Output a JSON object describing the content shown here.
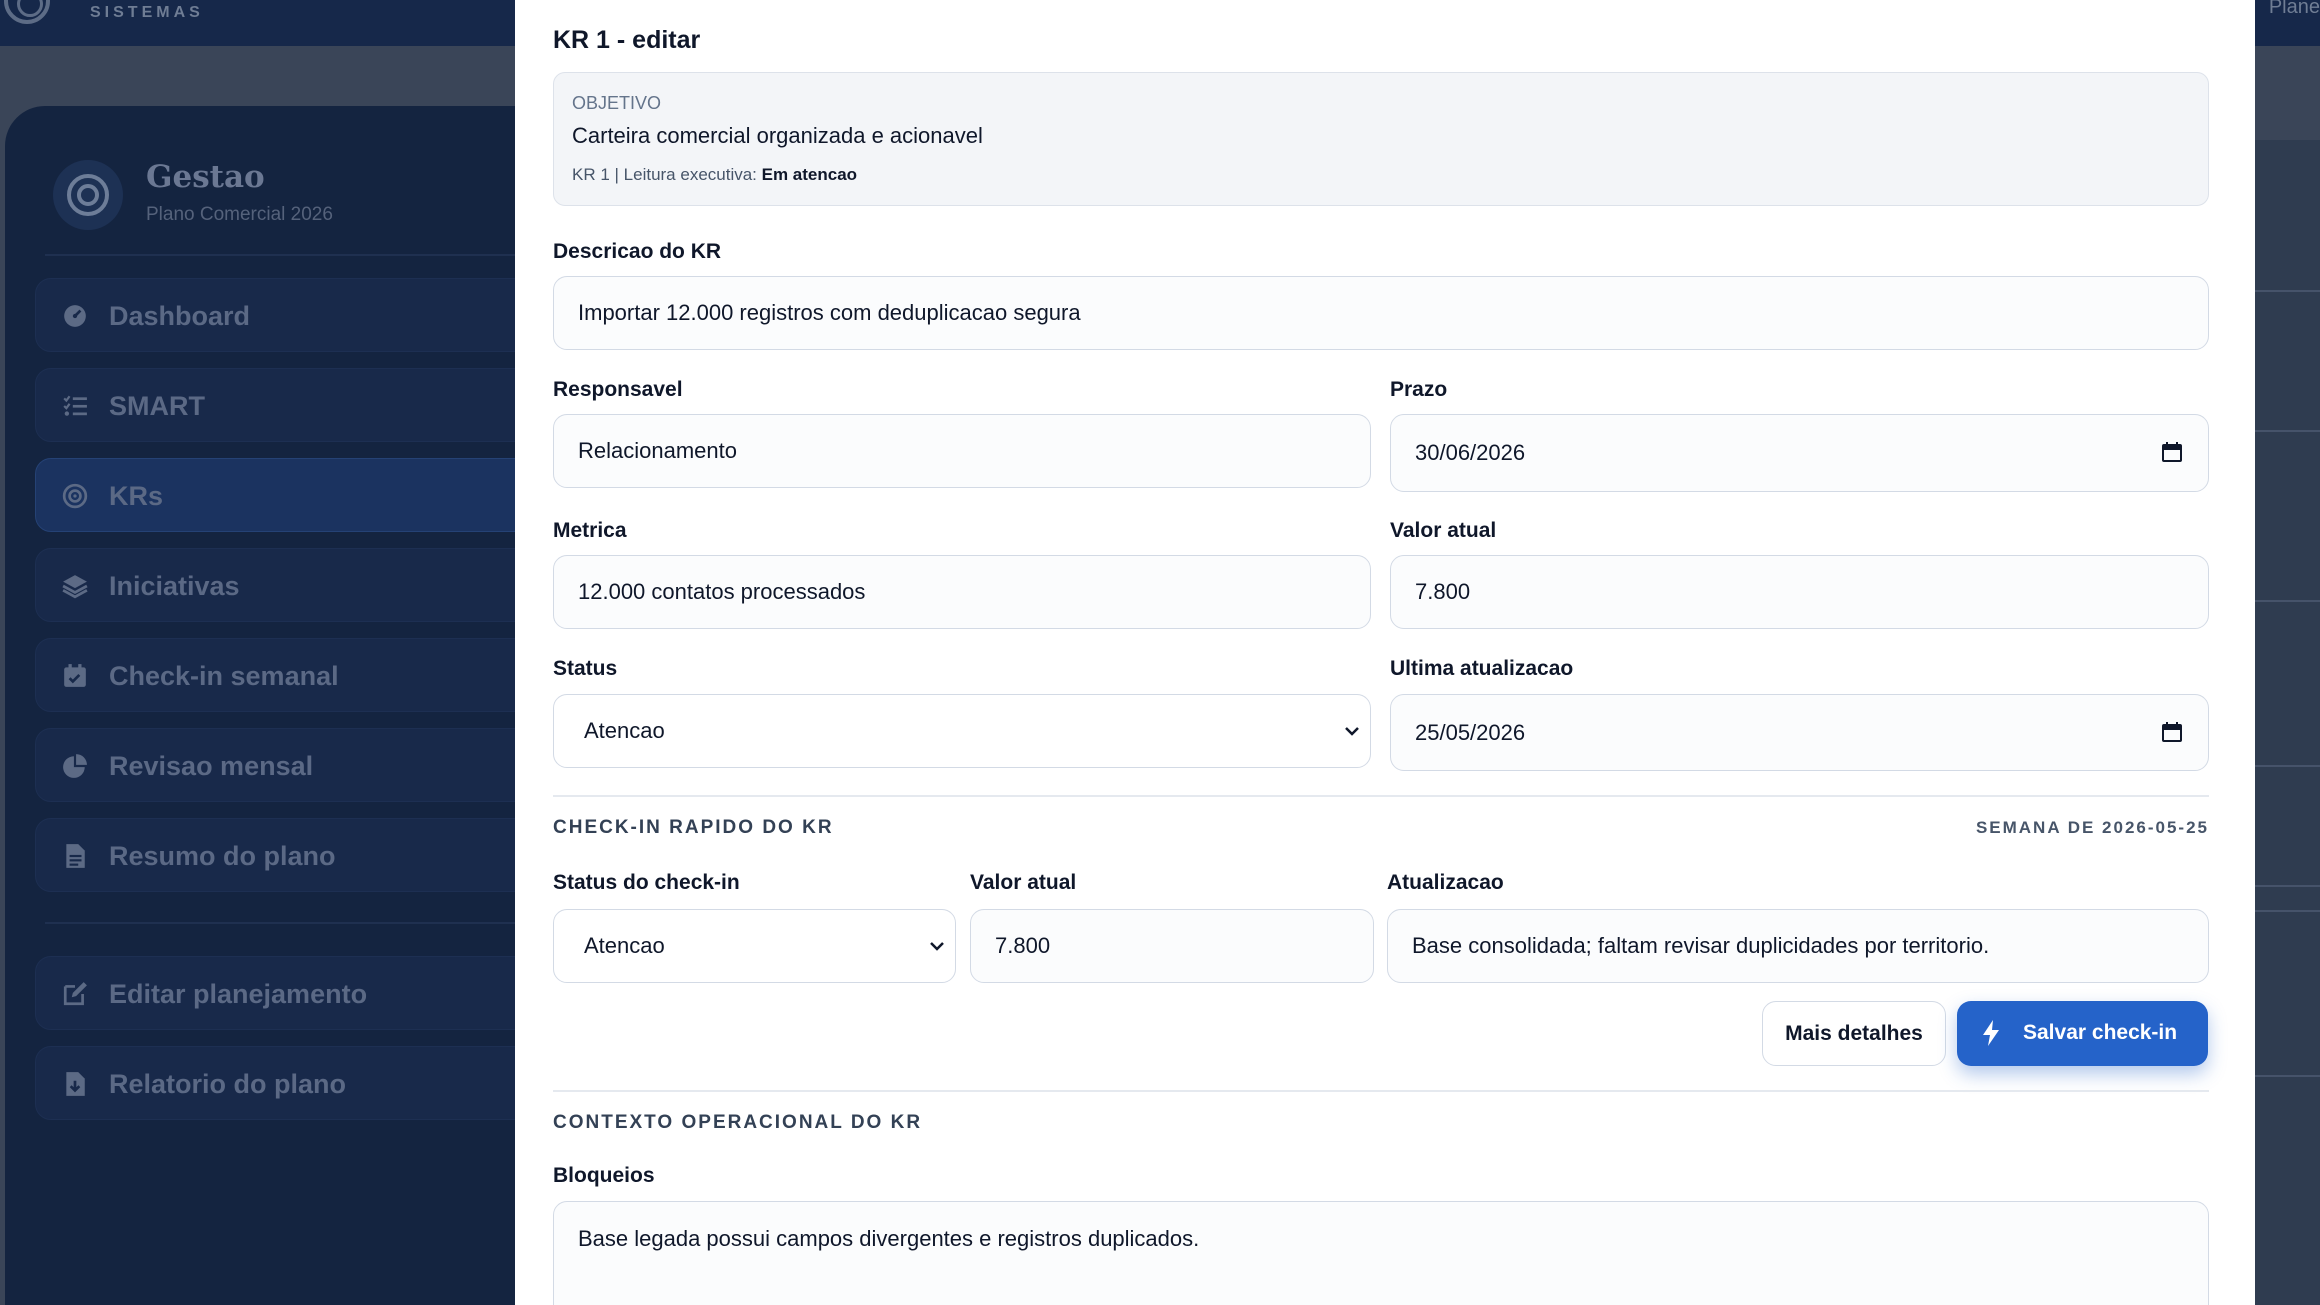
{
  "topbar": {
    "brand_sub": "SISTEMAS",
    "right_text": "Plane"
  },
  "sidebar": {
    "title": "Gestao",
    "subtitle": "Plano Comercial 2026",
    "items": [
      {
        "label": "Dashboard",
        "icon": "dashboard-icon"
      },
      {
        "label": "SMART",
        "icon": "checklist-icon"
      },
      {
        "label": "KRs",
        "icon": "target-icon",
        "active": true
      },
      {
        "label": "Iniciativas",
        "icon": "layers-icon"
      },
      {
        "label": "Check-in semanal",
        "icon": "calendar-check-icon"
      },
      {
        "label": "Revisao mensal",
        "icon": "pie-chart-icon"
      },
      {
        "label": "Resumo do plano",
        "icon": "document-icon"
      },
      {
        "label": "Editar planejamento",
        "icon": "edit-icon"
      },
      {
        "label": "Relatorio do plano",
        "icon": "file-report-icon"
      }
    ]
  },
  "modal": {
    "title": "KR 1 - editar",
    "objective": {
      "label": "OBJETIVO",
      "value": "Carteira comercial organizada e acionavel",
      "meta_prefix": "KR 1 | Leitura executiva: ",
      "meta_status": "Em atencao"
    },
    "form": {
      "descricao_label": "Descricao do KR",
      "descricao_value": "Importar 12.000 registros com deduplicacao segura",
      "responsavel_label": "Responsavel",
      "responsavel_value": "Relacionamento",
      "prazo_label": "Prazo",
      "prazo_value": "30/06/2026",
      "metrica_label": "Metrica",
      "metrica_value": "12.000 contatos processados",
      "valor_atual_label": "Valor atual",
      "valor_atual_value": "7.800",
      "status_label": "Status",
      "status_value": "Atencao",
      "ultima_label": "Ultima atualizacao",
      "ultima_value": "25/05/2026"
    },
    "checkin": {
      "section_title": "CHECK-IN RAPIDO DO KR",
      "week_label": "SEMANA DE 2026-05-25",
      "status_label": "Status do check-in",
      "status_value": "Atencao",
      "valor_label": "Valor atual",
      "valor_value": "7.800",
      "atualizacao_label": "Atualizacao",
      "atualizacao_value": "Base consolidada; faltam revisar duplicidades por territorio.",
      "more_button": "Mais detalhes",
      "save_button": "Salvar check-in"
    },
    "contexto": {
      "section_title": "CONTEXTO OPERACIONAL DO KR",
      "bloqueios_label": "Bloqueios",
      "bloqueios_value": "Base legada possui campos divergentes e registros duplicados."
    }
  },
  "colors": {
    "primary": "#2563c9",
    "sidebar_bg": "#142440",
    "topbar_bg": "#16284a"
  }
}
